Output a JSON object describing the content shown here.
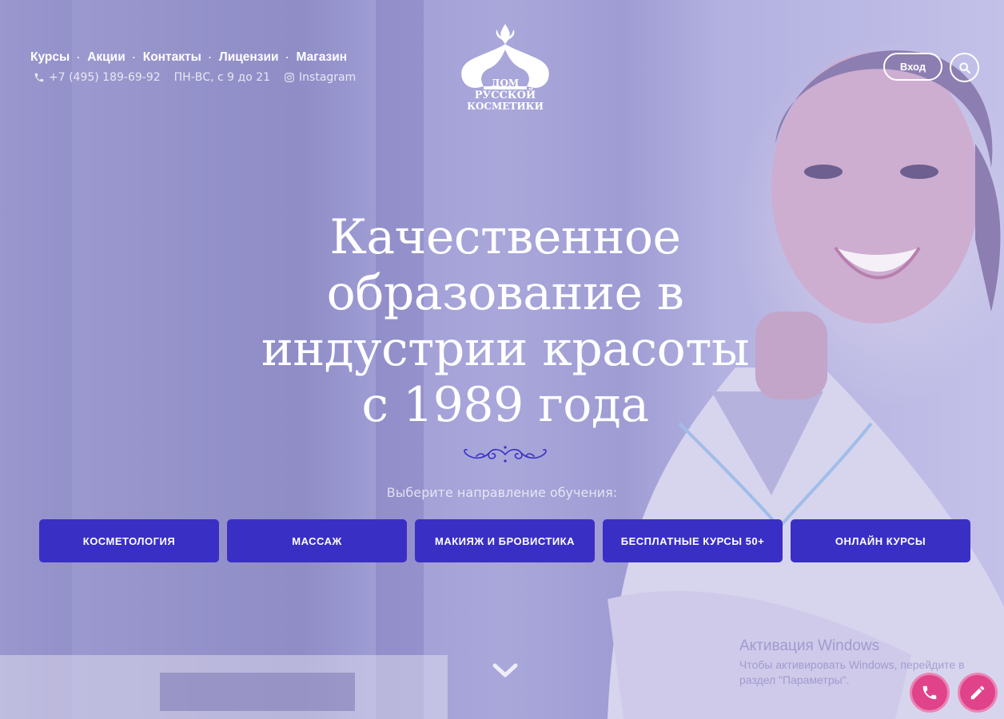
{
  "header": {
    "nav": [
      "Курсы",
      "Акции",
      "Контакты",
      "Лицензии",
      "Магазин"
    ],
    "nav_separator": "·",
    "phone": "+7 (495) 189-69-92",
    "hours": "ПН-ВС, с 9 до 21",
    "instagram": "Instagram",
    "login_label": "Вход",
    "logo_lines": [
      "ДОМ",
      "РУССКОЙ",
      "КОСМЕТИКИ"
    ]
  },
  "hero": {
    "headline_lines": [
      "Качественное",
      "образование в",
      "индустрии красоты",
      "с 1989 года"
    ],
    "choose_text": "Выберите направление обучения:",
    "directions": [
      "КОСМЕТОЛОГИЯ",
      "МАССАЖ",
      "МАКИЯЖ И БРОВИСТИКА",
      "БЕСПЛАТНЫЕ КУРСЫ 50+",
      "ОНЛАЙН КУРСЫ"
    ]
  },
  "watermark": {
    "title": "Активация Windows",
    "text": "Чтобы активировать Windows, перейдите в раздел \"Параметры\"."
  },
  "colors": {
    "overlay": "#9c9ad3",
    "button": "#3a2fc4",
    "fab": "#e0438a"
  },
  "icons": [
    "phone-icon",
    "instagram-icon",
    "search-icon",
    "chevron-down-icon",
    "pencil-icon"
  ]
}
